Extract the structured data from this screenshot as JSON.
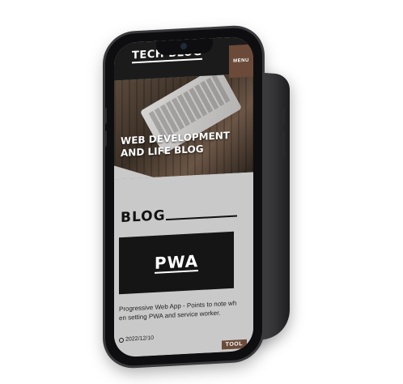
{
  "header": {
    "site_title": "TECH BLOG",
    "menu_label": "MENU"
  },
  "hero": {
    "title": "WEB DEVELOPMENT AND LIFE BLOG"
  },
  "section": {
    "heading": "BLOG"
  },
  "post": {
    "image_text": "PWA",
    "description": "Progressive Web App - Points to note when setting PWA and service worker.",
    "date": "2022/12/10",
    "tag": "TOOL"
  },
  "icons": {
    "date": "clock-icon"
  },
  "colors": {
    "accent": "#6b4a3a",
    "dark": "#1b1b1b",
    "background": "#c9c9c9"
  }
}
